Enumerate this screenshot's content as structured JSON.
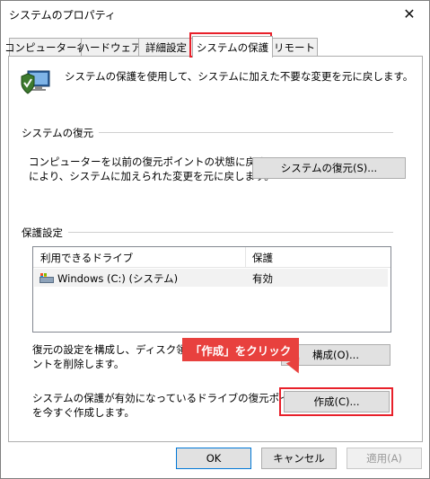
{
  "window": {
    "title": "システムのプロパティ"
  },
  "tabs": [
    {
      "label": "コンピューター名"
    },
    {
      "label": "ハードウェア"
    },
    {
      "label": "詳細設定"
    },
    {
      "label": "システムの保護"
    },
    {
      "label": "リモート"
    }
  ],
  "intro": "システムの保護を使用して、システムに加えた不要な変更を元に戻します。",
  "restore": {
    "group_label": "システムの復元",
    "description_line1": "コンピューターを以前の復元ポイントの状態に戻すこと",
    "description_line2": "により、システムに加えられた変更を元に戻します。",
    "button_label": "システムの復元(S)..."
  },
  "protection": {
    "group_label": "保護設定",
    "columns": [
      "利用できるドライブ",
      "保護"
    ],
    "rows": [
      {
        "drive": "Windows (C:) (システム)",
        "status": "有効"
      }
    ],
    "configure_line1": "復元の設定を構成し、ディスク領域",
    "configure_line2": "ントを削除します。",
    "configure_button": "構成(O)...",
    "create_line1": "システムの保護が有効になっているドライブの復元ポイント",
    "create_line2": "を今すぐ作成します。",
    "create_button": "作成(C)..."
  },
  "footer": {
    "ok": "OK",
    "cancel": "キャンセル",
    "apply": "適用(A)"
  },
  "annotation": {
    "callout": "「作成」をクリック"
  },
  "colors": {
    "highlight": "#e8202a",
    "callout_bg": "#e8413e"
  }
}
